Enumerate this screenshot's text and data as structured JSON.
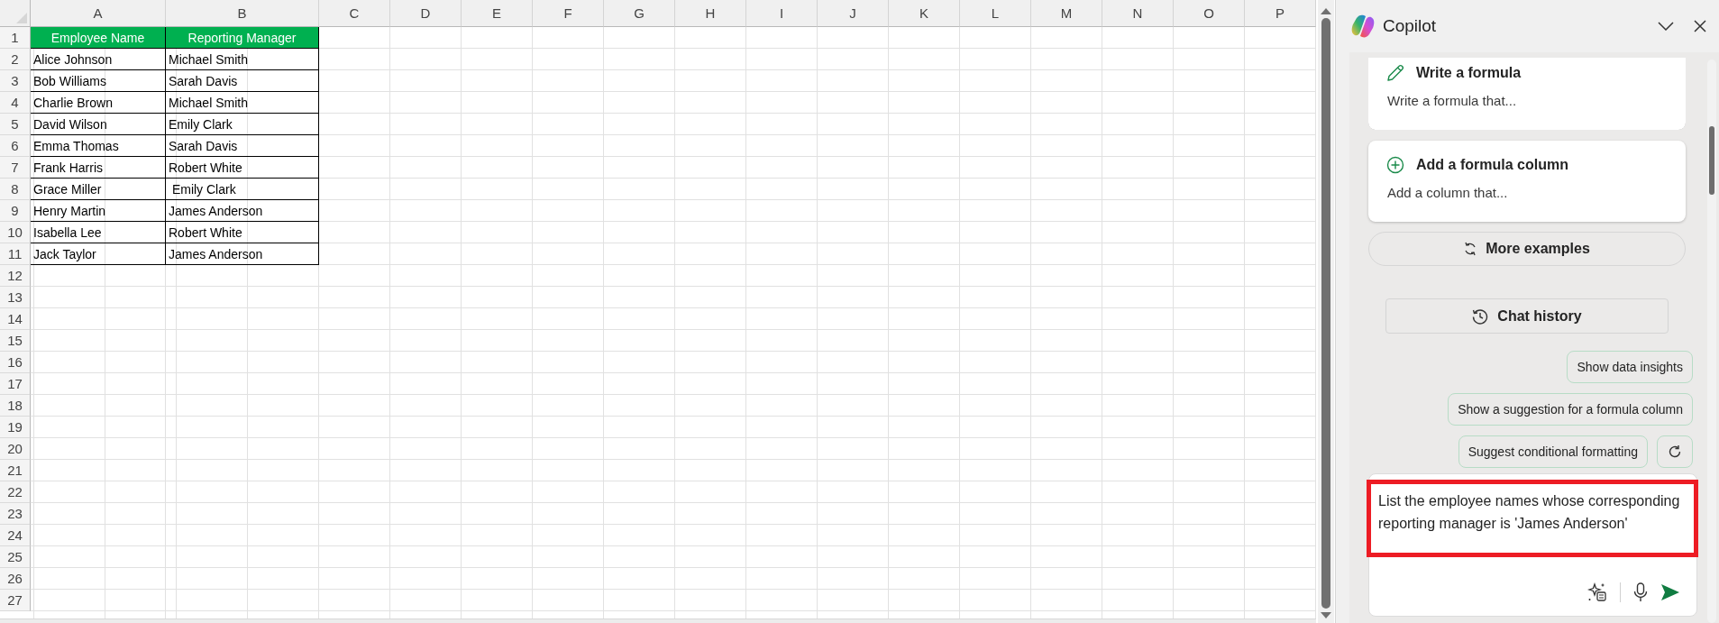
{
  "sheet": {
    "columns": [
      "A",
      "B",
      "C",
      "D",
      "E",
      "F",
      "G",
      "H",
      "I",
      "J",
      "K",
      "L",
      "M",
      "N",
      "O",
      "P"
    ],
    "row_numbers": [
      "1",
      "2",
      "3",
      "4",
      "5",
      "6",
      "7",
      "8",
      "9",
      "10",
      "11",
      "12",
      "13",
      "14",
      "15",
      "16",
      "17",
      "18",
      "19",
      "20",
      "21",
      "22",
      "23",
      "24",
      "25",
      "26",
      "27"
    ],
    "table_header": [
      "Employee Name",
      "Reporting Manager"
    ],
    "table_rows": [
      [
        "Alice Johnson",
        "Michael Smith"
      ],
      [
        "Bob Williams",
        "Sarah Davis"
      ],
      [
        "Charlie Brown",
        "Michael Smith"
      ],
      [
        "David Wilson",
        "Emily Clark"
      ],
      [
        "Emma Thomas",
        "Sarah Davis"
      ],
      [
        "Frank Harris",
        "Robert White"
      ],
      [
        "Grace Miller",
        " Emily Clark"
      ],
      [
        "Henry Martin",
        "James Anderson"
      ],
      [
        "Isabella Lee",
        "Robert White"
      ],
      [
        "Jack Taylor",
        "James Anderson"
      ]
    ]
  },
  "copilot": {
    "title": "Copilot",
    "cards": [
      {
        "kind": "pencil",
        "title": "Write a formula",
        "text": "Write a formula that..."
      },
      {
        "kind": "plus",
        "title": "Add a formula column",
        "text": "Add a column that..."
      }
    ],
    "more_examples": "More examples",
    "chat_history": "Chat history",
    "suggestions": [
      "Show data insights",
      "Show a suggestion for a formula column",
      "Suggest conditional formatting"
    ],
    "prompt": {
      "value": "List the employee names whose corresponding reporting manager is 'James Anderson'",
      "highlighted": true
    }
  }
}
